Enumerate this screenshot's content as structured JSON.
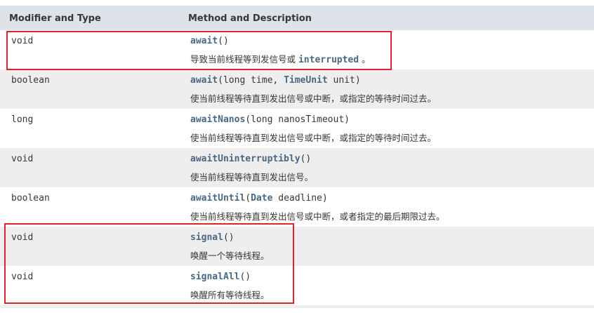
{
  "table": {
    "headers": {
      "modifier_type": "Modifier and Type",
      "method_desc": "Method and Description"
    },
    "rows": [
      {
        "type": "void",
        "method": "await",
        "sig_pre": "(",
        "sig_link": "",
        "sig_post": ")",
        "desc_text": "导致当前线程等到发信号或 ",
        "desc_code": "interrupted",
        "desc_after": " 。"
      },
      {
        "type": "boolean",
        "method": "await",
        "sig_pre": "(long time, ",
        "sig_link": "TimeUnit",
        "sig_post": " unit)",
        "desc_text": "使当前线程等待直到发出信号或中断，或指定的等待时间过去。",
        "desc_code": "",
        "desc_after": ""
      },
      {
        "type": "long",
        "method": "awaitNanos",
        "sig_pre": "(long nanosTimeout)",
        "sig_link": "",
        "sig_post": "",
        "desc_text": "使当前线程等待直到发出信号或中断，或指定的等待时间过去。",
        "desc_code": "",
        "desc_after": ""
      },
      {
        "type": "void",
        "method": "awaitUninterruptibly",
        "sig_pre": "()",
        "sig_link": "",
        "sig_post": "",
        "desc_text": "使当前线程等待直到发出信号。",
        "desc_code": "",
        "desc_after": ""
      },
      {
        "type": "boolean",
        "method": "awaitUntil",
        "sig_pre": "(",
        "sig_link": "Date",
        "sig_post": " deadline)",
        "desc_text": "使当前线程等待直到发出信号或中断，或者指定的最后期限过去。",
        "desc_code": "",
        "desc_after": ""
      },
      {
        "type": "void",
        "method": "signal",
        "sig_pre": "()",
        "sig_link": "",
        "sig_post": "",
        "desc_text": "唤醒一个等待线程。",
        "desc_code": "",
        "desc_after": ""
      },
      {
        "type": "void",
        "method": "signalAll",
        "sig_pre": "()",
        "sig_link": "",
        "sig_post": "",
        "desc_text": "唤醒所有等待线程。",
        "desc_code": "",
        "desc_after": ""
      }
    ]
  },
  "colors": {
    "header_bg": "#dee3e9",
    "alt_row_bg": "#eeeeef",
    "link": "#4a6782",
    "text": "#353833",
    "highlight_border": "#e0242f"
  }
}
